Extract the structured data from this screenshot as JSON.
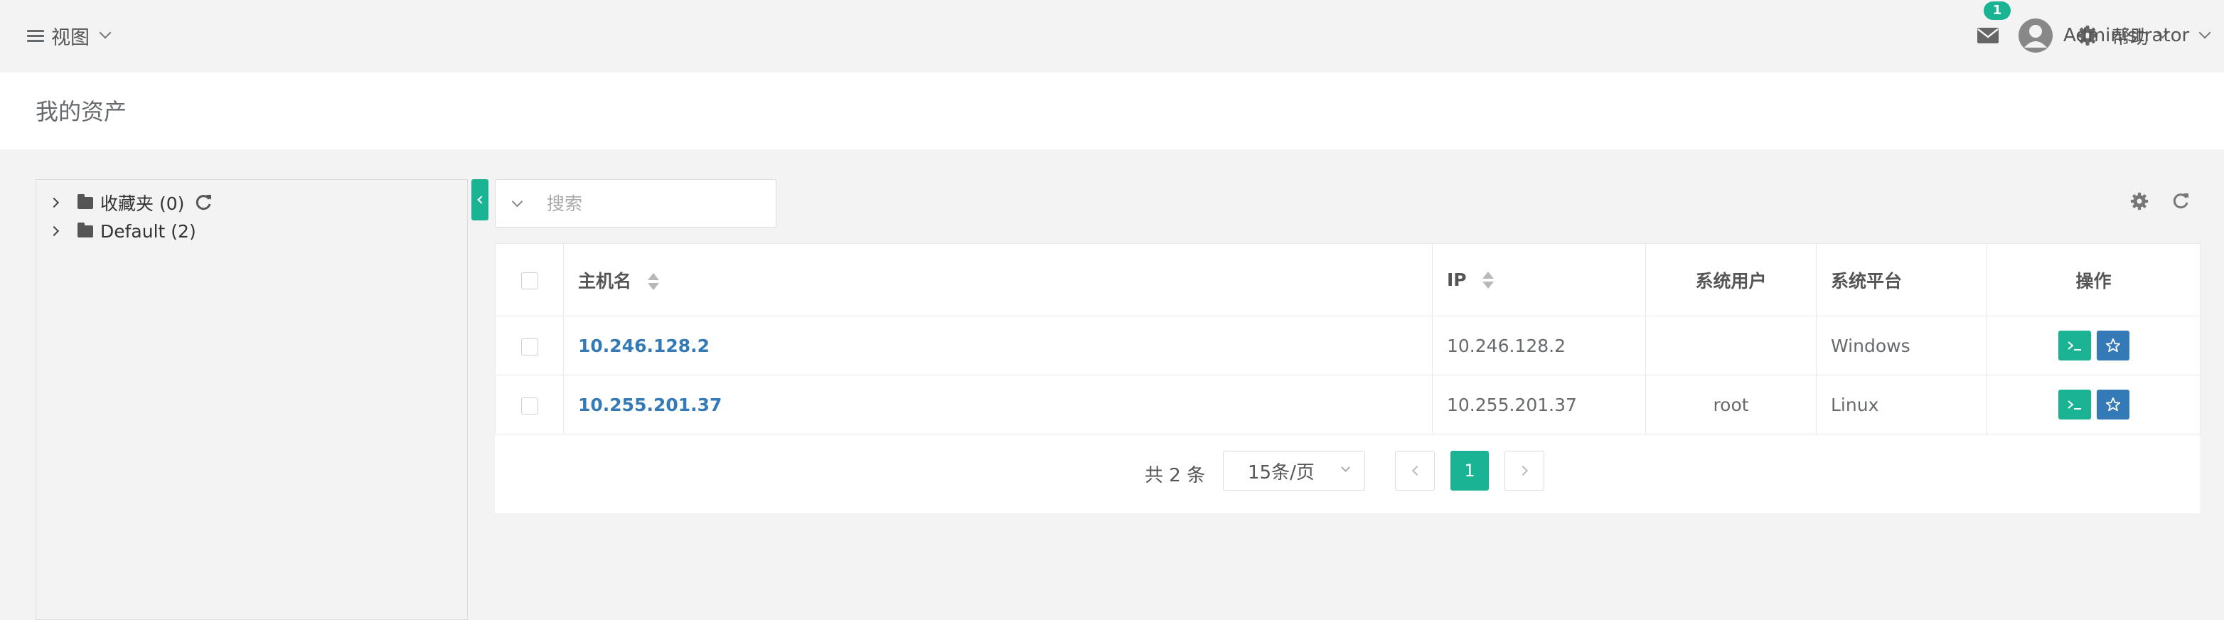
{
  "topbar": {
    "view_label": "视图",
    "mail_badge": "1",
    "help_label": "帮助",
    "user_name": "Administrator"
  },
  "page": {
    "title": "我的资产"
  },
  "tree": {
    "nodes": [
      {
        "label": "收藏夹 (0)"
      },
      {
        "label": "Default (2)"
      }
    ]
  },
  "search": {
    "placeholder": "搜索"
  },
  "table": {
    "headers": {
      "hostname": "主机名",
      "ip": "IP",
      "system_user": "系统用户",
      "platform": "系统平台",
      "actions": "操作"
    },
    "rows": [
      {
        "hostname": "10.246.128.2",
        "ip": "10.246.128.2",
        "system_user": "",
        "platform": "Windows"
      },
      {
        "hostname": "10.255.201.37",
        "ip": "10.255.201.37",
        "system_user": "root",
        "platform": "Linux"
      }
    ]
  },
  "pagination": {
    "total_text": "共 2 条",
    "page_size": "15条/页",
    "current_page": "1"
  },
  "colors": {
    "accent": "#1ab394",
    "link": "#337ab7"
  }
}
